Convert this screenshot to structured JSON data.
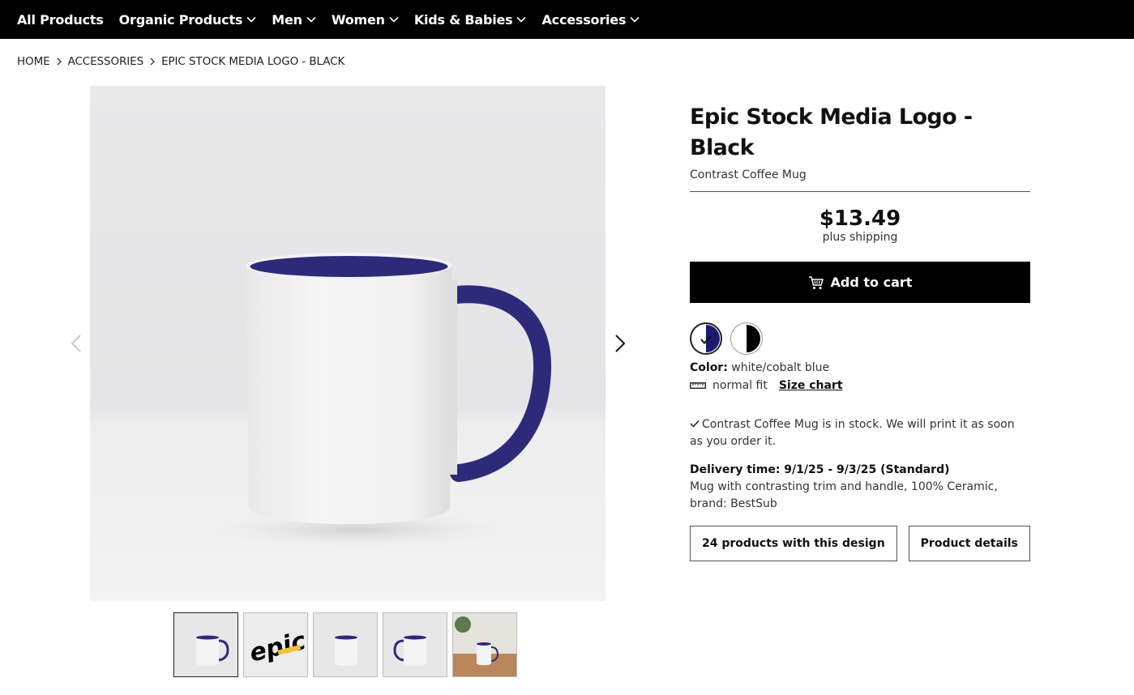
{
  "nav": {
    "items": [
      {
        "label": "All Products",
        "has_dropdown": false
      },
      {
        "label": "Organic Products",
        "has_dropdown": true
      },
      {
        "label": "Men",
        "has_dropdown": true
      },
      {
        "label": "Women",
        "has_dropdown": true
      },
      {
        "label": "Kids & Babies",
        "has_dropdown": true
      },
      {
        "label": "Accessories",
        "has_dropdown": true
      }
    ]
  },
  "breadcrumb": [
    "HOME",
    "ACCESSORIES",
    "EPIC STOCK MEDIA LOGO - BLACK"
  ],
  "product": {
    "title": "Epic Stock Media Logo - Black",
    "subtitle": "Contrast Coffee Mug",
    "price": "$13.49",
    "shipping": "plus shipping",
    "add_to_cart": "Add to cart",
    "color_label": "Color:",
    "color_value": "white/cobalt blue",
    "fit": "normal fit",
    "size_chart": "Size chart",
    "stock_message": "Contrast Coffee Mug is in stock. We will print it as soon as you order it.",
    "delivery_label": "Delivery time: 9/1/25 - 9/3/25 (Standard)",
    "description": "Mug with contrasting trim and handle, 100% Ceramic, brand: BestSub",
    "products_with_design": "24 products with this design",
    "product_details": "Product details"
  },
  "swatches": [
    {
      "name": "white/cobalt blue",
      "color": "#1a1a6e",
      "selected": true
    },
    {
      "name": "white/black",
      "color": "#000000",
      "selected": false
    }
  ],
  "thumbnails": [
    {
      "name": "mug-front-thumbnail",
      "active": true
    },
    {
      "name": "logo-design-thumbnail",
      "active": false
    },
    {
      "name": "mug-side-thumbnail",
      "active": false
    },
    {
      "name": "mug-back-thumbnail",
      "active": false
    },
    {
      "name": "mug-lifestyle-thumbnail",
      "active": false
    }
  ],
  "logo_text": "epic",
  "colors": {
    "nav_bg": "#000000",
    "accent_blue": "#2e2a7a",
    "button_bg": "#000000"
  },
  "icons": [
    "chevron-down-icon",
    "chevron-right-icon",
    "cart-icon",
    "ruler-icon",
    "check-icon",
    "arrow-left-icon",
    "arrow-right-icon"
  ]
}
